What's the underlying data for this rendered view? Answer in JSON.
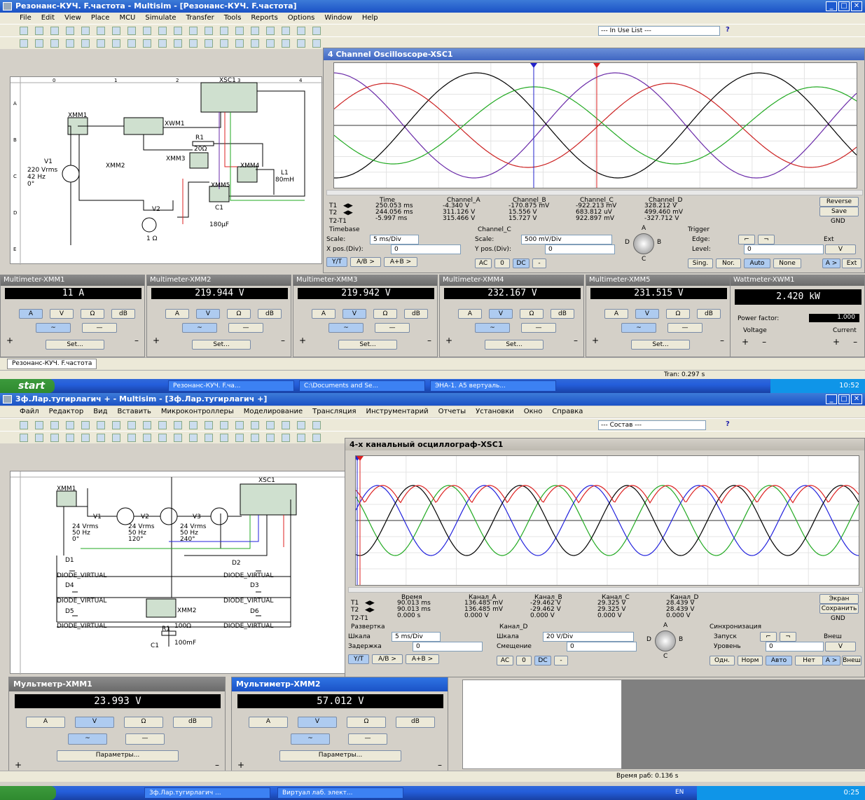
{
  "top": {
    "title": "Резонанс-КУЧ. F.частота - Multisim - [Резонанс-КУЧ. F.частота]",
    "menu": [
      "File",
      "Edit",
      "View",
      "Place",
      "MCU",
      "Simulate",
      "Transfer",
      "Tools",
      "Reports",
      "Options",
      "Window",
      "Help"
    ],
    "in_use_list": "--- In Use List ---",
    "schematic": {
      "xsc": "XSC1",
      "xmm1": "XMM1",
      "xwm1": "XWM1",
      "xmm2": "XMM2",
      "xmm3": "XMM3",
      "xmm4": "XMM4",
      "xmm5": "XMM5",
      "r1": "R1",
      "r1v": "20Ω",
      "v1": "V1",
      "v1a": "220 Vrms",
      "v1b": "42 Hz",
      "v1c": "0°",
      "l1": "L1",
      "l1v": "80mH",
      "c1": "C1",
      "c1v": "180µF",
      "v2": "V2",
      "r1o": "1 Ω",
      "cols": [
        "0",
        "1",
        "2",
        "3",
        "4"
      ],
      "rows": [
        "A",
        "B",
        "C",
        "D",
        "E"
      ]
    },
    "osc": {
      "title": "4 Channel Oscilloscope-XSC1",
      "h_time": "Time",
      "h_a": "Channel_A",
      "h_b": "Channel_B",
      "h_c": "Channel_C",
      "h_d": "Channel_D",
      "t1": "T1",
      "t2": "T2",
      "t21": "T2-T1",
      "r1": [
        "250.053 ms",
        "-4.340 V",
        "-170.875 mV",
        "-922.213 mV",
        "328.212 V"
      ],
      "r2": [
        "244.056 ms",
        "311.126 V",
        "15.556 V",
        "683.812 uV",
        "499.460 mV"
      ],
      "r3": [
        "-5.997 ms",
        "315.466 V",
        "15.727 V",
        "922.897 mV",
        "-327.712 V"
      ],
      "reverse": "Reverse",
      "save": "Save",
      "gnd": "GND",
      "timebase": "Timebase",
      "scale": "Scale:",
      "scale_v": "5 ms/Div",
      "xpos": "X pos.(Div):",
      "xpos_v": "0",
      "chan": "Channel_C",
      "cscale": "Scale:",
      "cscale_v": "500 mV/Div",
      "ypos": "Y pos.(Div):",
      "ypos_v": "0",
      "trigger": "Trigger",
      "edge": "Edge:",
      "level": "Level:",
      "level_v": "0",
      "level_u": "V",
      "ext": "Ext",
      "yt": "Y/T",
      "ab": "A/B >",
      "apb": "A+B >",
      "ac": "AC",
      "zero": "0",
      "dc": "DC",
      "minus": "-",
      "sing": "Sing.",
      "nor": "Nor.",
      "auto": "Auto",
      "none": "None",
      "a_btn": "A >",
      "ext_btn": "Ext",
      "knob_a": "A",
      "knob_b": "B",
      "knob_c": "C",
      "knob_d": "D"
    },
    "meters": [
      {
        "title": "Multimeter-XMM1",
        "value": "11 A",
        "active": "A"
      },
      {
        "title": "Multimeter-XMM2",
        "value": "219.944 V",
        "active": "V"
      },
      {
        "title": "Multimeter-XMM3",
        "value": "219.942 V",
        "active": "V"
      },
      {
        "title": "Multimeter-XMM4",
        "value": "232.167 V",
        "active": "V"
      },
      {
        "title": "Multimeter-XMM5",
        "value": "231.515 V",
        "active": "V"
      }
    ],
    "meter_btns": [
      "A",
      "V",
      "Ω",
      "dB"
    ],
    "set": "Set...",
    "watt": {
      "title": "Wattmeter-XWM1",
      "value": "2.420 kW",
      "pf_label": "Power factor:",
      "pf": "1.000",
      "voltage": "Voltage",
      "current": "Current"
    },
    "doc_tab": "Резонанс-КУЧ. F.частота",
    "tran": "Tran: 0.297 s",
    "taskbar": {
      "start": "start",
      "tasks": [
        "Резонанс-КУЧ. F.ча...",
        "C:\\Documents and Se...",
        "ЭНА-1. А5 вертуаль..."
      ],
      "clock": "10:52"
    }
  },
  "bottom": {
    "title": "3ф.Лар.тугирлагич + - Multisim - [3ф.Лар.тугирлагич +]",
    "menu": [
      "Файл",
      "Редактор",
      "Вид",
      "Вставить",
      "Микроконтроллеры",
      "Моделирование",
      "Трансляция",
      "Инструментарий",
      "Отчеты",
      "Установки",
      "Окно",
      "Справка"
    ],
    "in_use_list": "--- Состав ---",
    "schematic": {
      "xsc": "XSC1",
      "xmm1": "XMM1",
      "xmm2": "XMM2",
      "v1": "V1",
      "v2": "V2",
      "v3": "V3",
      "v_val": "24 Vrms",
      "f_val": "50 Hz",
      "p1": "0°",
      "p2": "120°",
      "p3": "240°",
      "d1": "D1",
      "d2": "D2",
      "d3": "D3",
      "d4": "D4",
      "d5": "D5",
      "d6": "D6",
      "dv": "DIODE_VIRTUAL",
      "r1": "R1",
      "r1v": "100Ω",
      "c1": "C1",
      "c1v": "100mF"
    },
    "osc": {
      "title": "4-х канальный осциллограф-XSC1",
      "h_time": "Время",
      "h_a": "Канал_A",
      "h_b": "Канал_B",
      "h_c": "Канал_C",
      "h_d": "Канал_D",
      "t1": "T1",
      "t2": "T2",
      "t21": "T2-T1",
      "r1": [
        "90.013 ms",
        "136.485 mV",
        "-29.462 V",
        "29.325 V",
        "28.439 V"
      ],
      "r2": [
        "90.013 ms",
        "136.485 mV",
        "-29.462 V",
        "29.325 V",
        "28.439 V"
      ],
      "r3": [
        "0.000 s",
        "0.000 V",
        "0.000 V",
        "0.000 V",
        "0.000 V"
      ],
      "reverse": "Экран",
      "save": "Сохранить",
      "gnd": "GND",
      "timebase": "Развертка",
      "scale": "Шкала",
      "scale_v": "5 ms/Div",
      "xpos": "Задержка",
      "xpos_v": "0",
      "chan": "Канал_D",
      "cscale": "Шкала",
      "cscale_v": "20 V/Div",
      "ypos": "Смещение",
      "ypos_v": "0",
      "trigger": "Синхронизация",
      "edge": "Запуск",
      "level": "Уровень",
      "level_v": "0",
      "level_u": "V",
      "ext": "Внеш",
      "yt": "Y/T",
      "ab": "A/B >",
      "apb": "A+B >",
      "ac": "AC",
      "zero": "0",
      "dc": "DC",
      "minus": "-",
      "sing": "Одн.",
      "nor": "Норм",
      "auto": "Авто",
      "none": "Нет",
      "a_btn": "A >",
      "ext_btn": "Внеш",
      "knob_a": "A",
      "knob_b": "B",
      "knob_c": "C",
      "knob_d": "D"
    },
    "meters": [
      {
        "title": "Мультметр-XMM1",
        "value": "23.993 V"
      },
      {
        "title": "Мультиметр-XMM2",
        "value": "57.012 V"
      }
    ],
    "meter_btns": [
      "A",
      "V",
      "Ω",
      "dB"
    ],
    "params": "Параметры...",
    "run_time": "Время раб: 0.136 s",
    "taskbar": {
      "tasks": [
        "3ф.Лар.тугирлагич ...",
        "Виртуал лаб. элект..."
      ],
      "lang": "EN",
      "clock": "0:25"
    }
  }
}
